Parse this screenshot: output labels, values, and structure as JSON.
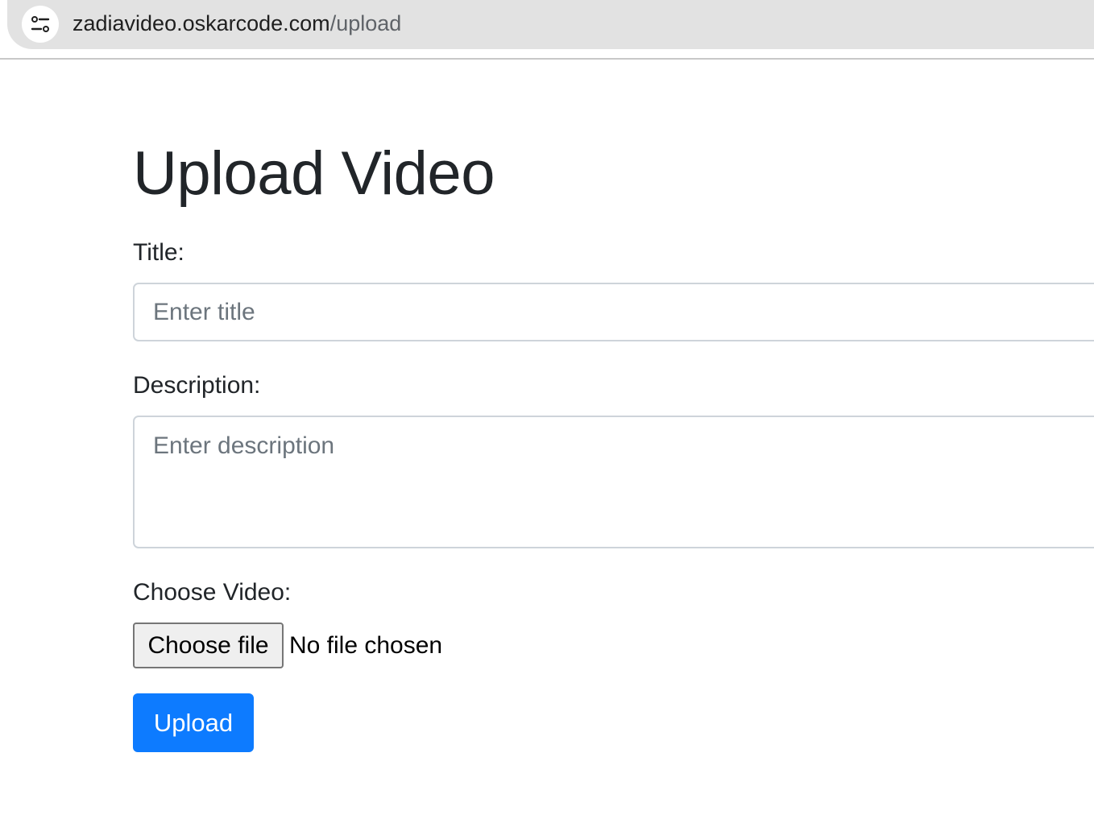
{
  "browser": {
    "url_host": "zadiavideo.oskarcode.com",
    "url_path": "/upload",
    "site_info_icon": "tune-icon"
  },
  "page": {
    "title": "Upload Video"
  },
  "form": {
    "title_label": "Title:",
    "title_placeholder": "Enter title",
    "title_value": "",
    "description_label": "Description:",
    "description_placeholder": "Enter description",
    "description_value": "",
    "video_label": "Choose Video:",
    "choose_file_label": "Choose file",
    "file_status": "No file chosen",
    "submit_label": "Upload"
  },
  "colors": {
    "primary": "#0d7bff",
    "text": "#212529",
    "placeholder": "#6c757d",
    "input_border": "#ced4da"
  }
}
